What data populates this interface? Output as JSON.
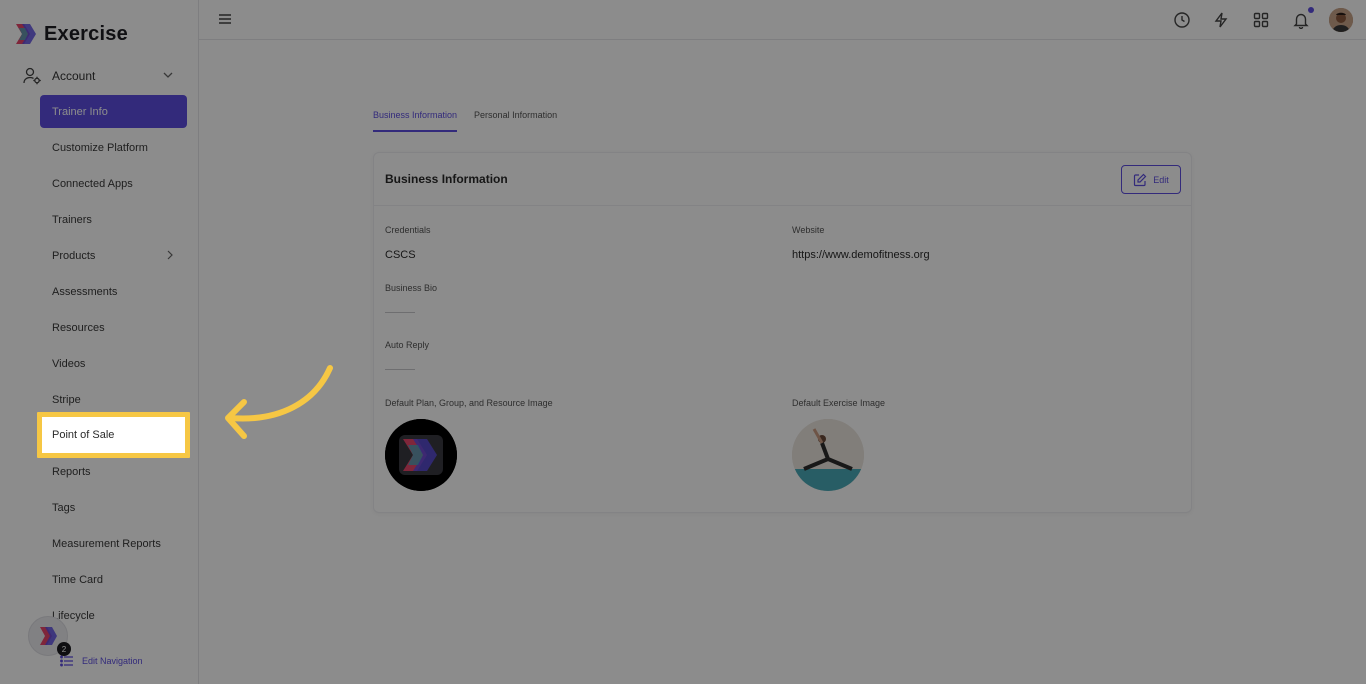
{
  "app": {
    "name": "Exercise"
  },
  "sidebar": {
    "section_label": "Account",
    "items": [
      {
        "label": "Trainer Info",
        "active": true
      },
      {
        "label": "Customize Platform"
      },
      {
        "label": "Connected Apps"
      },
      {
        "label": "Trainers"
      },
      {
        "label": "Products",
        "has_children": true
      },
      {
        "label": "Assessments"
      },
      {
        "label": "Resources"
      },
      {
        "label": "Videos"
      },
      {
        "label": "Stripe"
      },
      {
        "label": "Point of Sale",
        "highlighted": true
      },
      {
        "label": "Reports"
      },
      {
        "label": "Tags"
      },
      {
        "label": "Measurement Reports"
      },
      {
        "label": "Time Card"
      },
      {
        "label": "Lifecycle"
      }
    ],
    "fab_badge": "2",
    "edit_nav_label": "Edit Navigation"
  },
  "topbar": {
    "icons": [
      "clock-icon",
      "lightning-icon",
      "apps-grid-icon",
      "bell-icon",
      "avatar"
    ]
  },
  "tabs": [
    {
      "label": "Business Information",
      "active": true
    },
    {
      "label": "Personal Information"
    }
  ],
  "card": {
    "title": "Business Information",
    "edit_label": "Edit",
    "fields": {
      "credentials_label": "Credentials",
      "credentials_value": "CSCS",
      "website_label": "Website",
      "website_value": "https://www.demofitness.org",
      "bio_label": "Business Bio",
      "auto_reply_label": "Auto Reply",
      "default_plan_image_label": "Default Plan, Group, and Resource Image",
      "default_exercise_image_label": "Default Exercise Image"
    }
  },
  "colors": {
    "accent": "#5d4ee0",
    "highlight": "#f6c744",
    "overlay": "rgba(0,0,0,0.45)"
  }
}
